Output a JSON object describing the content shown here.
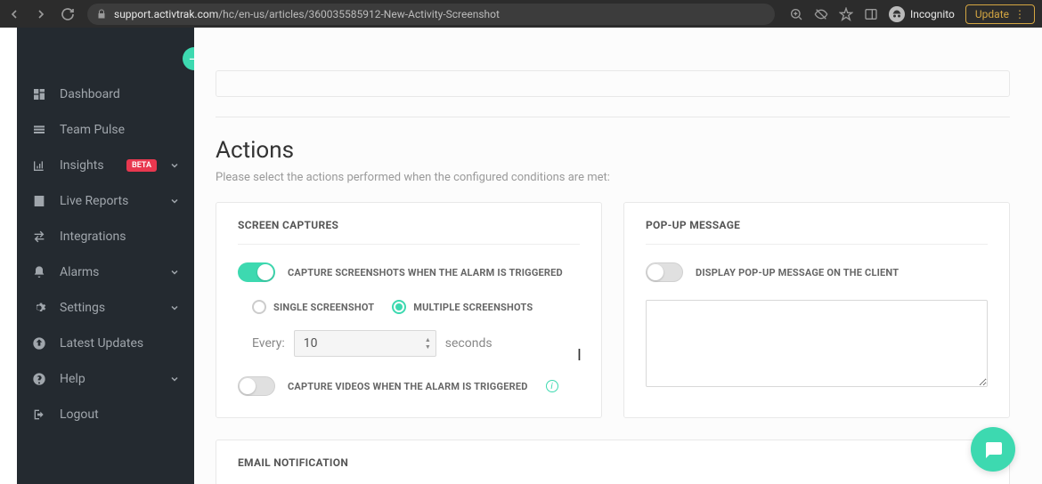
{
  "browser": {
    "url_domain": "support.activtrak.com",
    "url_path": "/hc/en-us/articles/360035585912-New-Activity-Screenshot",
    "incognito_label": "Incognito",
    "update_label": "Update"
  },
  "sidebar": {
    "collapse": "—",
    "items": [
      {
        "label": "Dashboard",
        "expandable": false
      },
      {
        "label": "Team Pulse",
        "expandable": false
      },
      {
        "label": "Insights",
        "expandable": true,
        "badge": "BETA"
      },
      {
        "label": "Live Reports",
        "expandable": true
      },
      {
        "label": "Integrations",
        "expandable": false
      },
      {
        "label": "Alarms",
        "expandable": true
      },
      {
        "label": "Settings",
        "expandable": true
      },
      {
        "label": "Latest Updates",
        "expandable": false
      },
      {
        "label": "Help",
        "expandable": true
      },
      {
        "label": "Logout",
        "expandable": false
      }
    ]
  },
  "actions": {
    "title": "Actions",
    "description": "Please select the actions performed when the configured conditions are met:",
    "screen_captures": {
      "header": "SCREEN CAPTURES",
      "toggle_label": "CAPTURE SCREENSHOTS WHEN THE ALARM IS TRIGGERED",
      "single_label": "SINGLE SCREENSHOT",
      "multiple_label": "MULTIPLE SCREENSHOTS",
      "every_label": "Every:",
      "every_value": "10",
      "every_unit": "seconds",
      "video_label": "CAPTURE VIDEOS WHEN THE ALARM IS TRIGGERED"
    },
    "popup": {
      "header": "POP-UP MESSAGE",
      "toggle_label": "DISPLAY POP-UP MESSAGE ON THE CLIENT"
    },
    "email": {
      "header": "EMAIL NOTIFICATION"
    }
  }
}
